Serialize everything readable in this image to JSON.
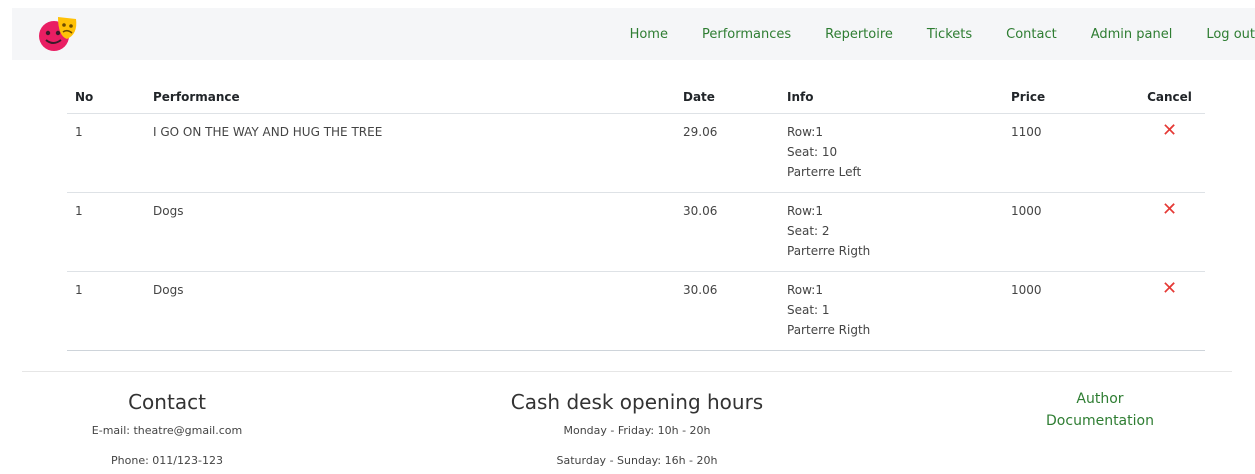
{
  "nav": {
    "items": [
      "Home",
      "Performances",
      "Repertoire",
      "Tickets",
      "Contact",
      "Admin panel",
      "Log out"
    ]
  },
  "table": {
    "headers": {
      "no": "No",
      "performance": "Performance",
      "date": "Date",
      "info": "Info",
      "price": "Price",
      "cancel": "Cancel"
    },
    "rows": [
      {
        "no": "1",
        "performance": "I GO ON THE WAY AND HUG THE TREE",
        "date": "29.06",
        "row": "Row:1",
        "seat": "Seat: 10",
        "section": "Parterre Left",
        "price": "1100"
      },
      {
        "no": "1",
        "performance": "Dogs",
        "date": "30.06",
        "row": "Row:1",
        "seat": "Seat: 2",
        "section": "Parterre Rigth",
        "price": "1000"
      },
      {
        "no": "1",
        "performance": "Dogs",
        "date": "30.06",
        "row": "Row:1",
        "seat": "Seat: 1",
        "section": "Parterre Rigth",
        "price": "1000"
      }
    ],
    "cancel_icon": "✕"
  },
  "footer": {
    "contact": {
      "title": "Contact",
      "email": "E-mail: theatre@gmail.com",
      "phone": "Phone: 011/123-123"
    },
    "hours": {
      "title": "Cash desk opening hours",
      "weekdays": "Monday - Friday: 10h - 20h",
      "weekend": "Saturday - Sunday: 16h - 20h"
    },
    "links": {
      "author": "Author",
      "documentation": "Documentation"
    }
  },
  "colors": {
    "accent": "#2e7d32",
    "cancel": "#e53935",
    "navbar_bg": "#f5f6f8"
  }
}
